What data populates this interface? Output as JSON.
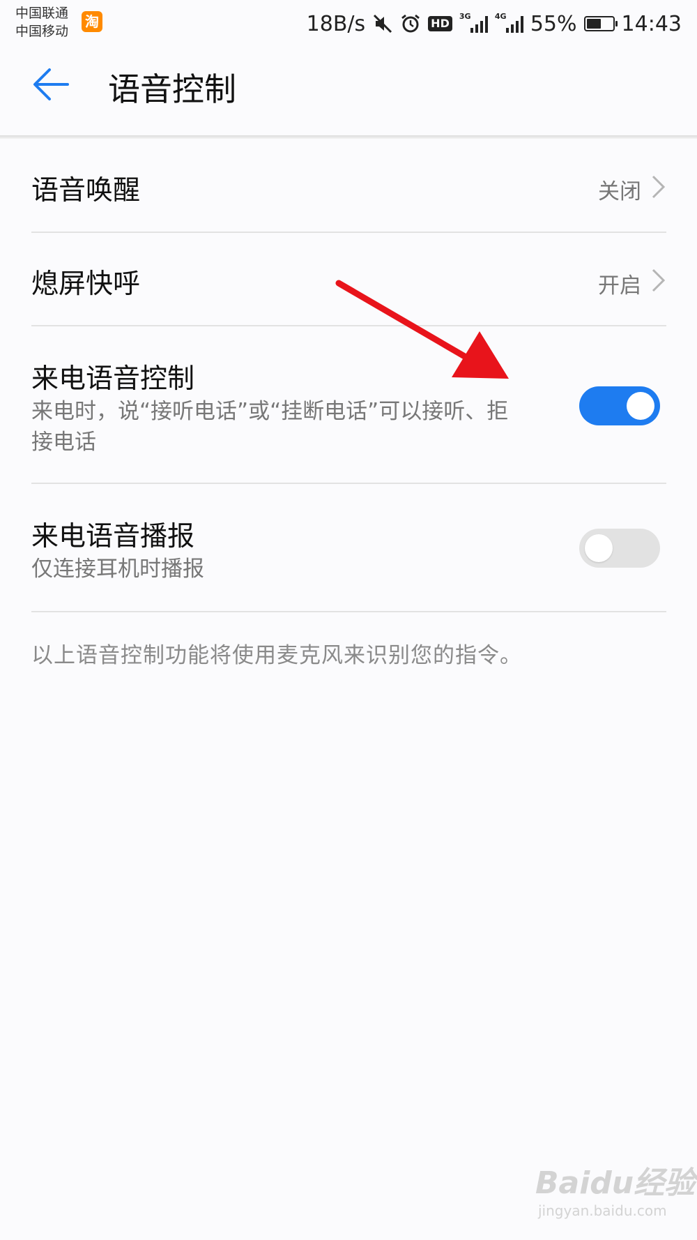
{
  "status_bar": {
    "carrier_1": "中国联通",
    "carrier_2": "中国移动",
    "taobao_badge": "淘",
    "net_speed": "18B/s",
    "hd_label": "HD",
    "signal_1_label": "3G",
    "signal_2_label": "4G",
    "battery_percent": "55%",
    "battery_level": 0.55,
    "time": "14:43"
  },
  "header": {
    "title": "语音控制",
    "back_icon": "arrow-left-icon"
  },
  "settings": {
    "voice_wakeup": {
      "label": "语音唤醒",
      "value": "关闭"
    },
    "screen_off_call": {
      "label": "熄屏快呼",
      "value": "开启"
    },
    "incoming_voice_control": {
      "label": "来电语音控制",
      "description": "来电时，说“接听电话”或“挂断电话”可以接听、拒接电话",
      "enabled": true
    },
    "incoming_voice_broadcast": {
      "label": "来电语音播报",
      "description": "仅连接耳机时播报",
      "enabled": false
    }
  },
  "footer_note": "以上语音控制功能将使用麦克风来识别您的指令。",
  "annotation": {
    "arrow_color": "#e8141b"
  },
  "watermark": {
    "brand": "Baidu经验",
    "url": "jingyan.baidu.com"
  },
  "colors": {
    "accent": "#1e7cf0",
    "toggle_off": "#e2e2e2"
  }
}
